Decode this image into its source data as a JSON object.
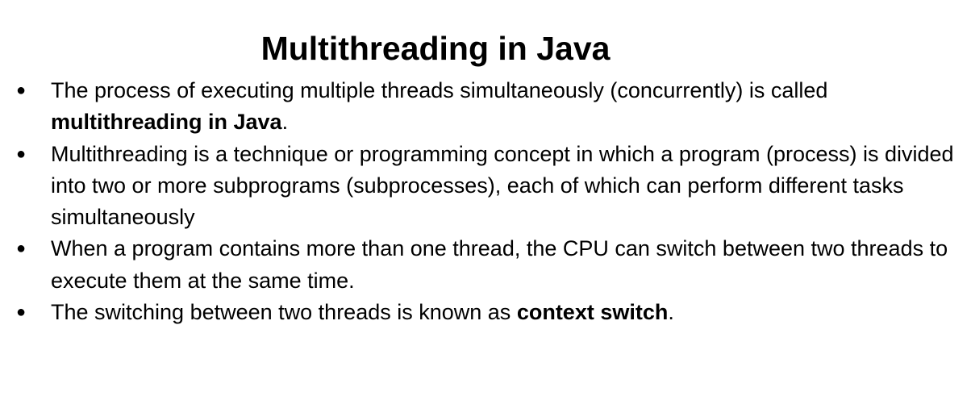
{
  "slide": {
    "title": "Multithreading in Java",
    "bullet_glyph": "●",
    "bullets": [
      {
        "text": "The process of executing multiple threads simultaneously (concurrently) is called ",
        "bold": "multithreading in Java",
        "after": "."
      },
      {
        "text": "Multithreading is a technique or programming concept in which a program (process) is divided into two or more subprograms (subprocesses), each of which can perform different tasks simultaneously",
        "bold": "",
        "after": ""
      },
      {
        "text": "When a program contains more than one thread, the CPU can switch between two threads to execute them at the same time.",
        "bold": "",
        "after": ""
      },
      {
        "text": "The switching between two threads is known as ",
        "bold": "context switch",
        "after": "."
      }
    ]
  }
}
